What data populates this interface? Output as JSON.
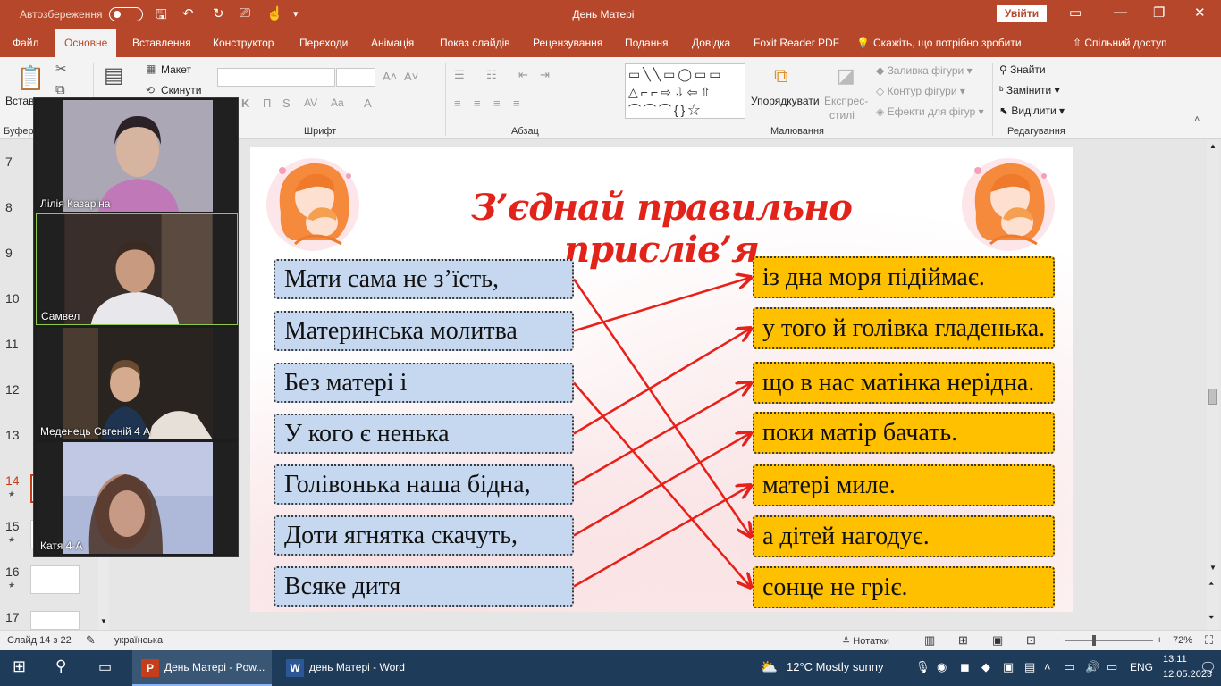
{
  "window": {
    "autosave_label": "Автозбереження",
    "title": "День Матері",
    "sign_in": "Увійти"
  },
  "tabs": [
    {
      "label": "Файл"
    },
    {
      "label": "Основне"
    },
    {
      "label": "Вставлення"
    },
    {
      "label": "Конструктор"
    },
    {
      "label": "Переходи"
    },
    {
      "label": "Анімація"
    },
    {
      "label": "Показ слайдів"
    },
    {
      "label": "Рецензування"
    },
    {
      "label": "Подання"
    },
    {
      "label": "Довідка"
    },
    {
      "label": "Foxit Reader PDF"
    },
    {
      "label": "Скажіть, що потрібно зробити"
    }
  ],
  "share_label": "Спільний доступ",
  "ribbon": {
    "paste": "Встав",
    "layout": "Макет",
    "reset": "Скинути",
    "clipboard_group": "Буфер",
    "font_group": "Шрифт",
    "paragraph_group": "Абзац",
    "arrange": "Упорядкувати",
    "quick_styles_1": "Експрес-",
    "quick_styles_2": "стилі",
    "shape_fill": "Заливка фігури",
    "shape_outline": "Контур фігури",
    "shape_effects": "Ефекти для фігур",
    "drawing_group": "Малювання",
    "find": "Знайти",
    "replace": "Замінити",
    "select": "Виділити",
    "editing_group": "Редагування"
  },
  "slides_panel": {
    "numbers": [
      "7",
      "8",
      "9",
      "10",
      "11",
      "12",
      "13",
      "14",
      "15",
      "16",
      "17"
    ],
    "active": "14"
  },
  "video_call": {
    "participants": [
      {
        "name": "Лілія Казаріна"
      },
      {
        "name": "Самвел"
      },
      {
        "name": "Меденець Євгеній 4 А"
      },
      {
        "name": "Катя  4-А"
      }
    ]
  },
  "slide": {
    "title": "З’єднай правильно прислів’я",
    "left_phrases": [
      "Мати сама не з’їсть,",
      "Материнська молитва",
      "Без  матері і",
      "У кого є ненька",
      "Голівонька наша  бідна,",
      "Доти ягнятка скачуть,",
      "Всяке дитя"
    ],
    "right_phrases": [
      "із дна моря підіймає.",
      "у того й голівка гладенька.",
      "що в нас матінка нерідна.",
      "поки матір бачать.",
      "матері миле.",
      "а дітей нагодує.",
      "сонце не гріє."
    ],
    "connections": [
      [
        0,
        5
      ],
      [
        1,
        0
      ],
      [
        2,
        6
      ],
      [
        3,
        1
      ],
      [
        4,
        2
      ],
      [
        5,
        3
      ],
      [
        6,
        4
      ]
    ],
    "arrow_color": "#e8201a"
  },
  "statusbar": {
    "slide_counter": "Слайд 14 з 22",
    "language": "українська",
    "notes": "Нотатки",
    "zoom": "72%"
  },
  "taskbar": {
    "apps": [
      {
        "label": "День Матері - Pow..."
      },
      {
        "label": "день Матері - Word"
      }
    ],
    "weather": "12°C  Mostly sunny",
    "lang": "ENG",
    "time": "13:11",
    "date": "12.05.2023"
  }
}
